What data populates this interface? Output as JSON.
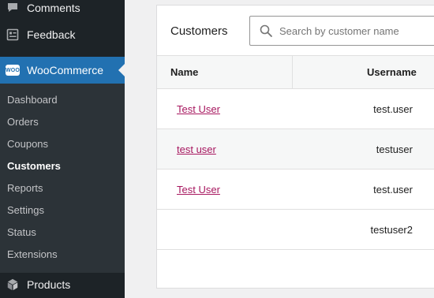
{
  "sidebar": {
    "top_items": [
      {
        "label": "Comments",
        "icon": "comment-icon"
      },
      {
        "label": "Feedback",
        "icon": "feedback-icon"
      }
    ],
    "woocommerce": {
      "label": "WooCommerce",
      "badge": "WOO",
      "icon": "woocommerce-icon"
    },
    "submenu": [
      "Dashboard",
      "Orders",
      "Coupons",
      "Customers",
      "Reports",
      "Settings",
      "Status",
      "Extensions"
    ],
    "current_submenu": "Customers",
    "products": {
      "label": "Products",
      "icon": "products-icon"
    }
  },
  "customers_card": {
    "title": "Customers",
    "search_placeholder": "Search by customer name"
  },
  "table": {
    "columns": [
      "Name",
      "Username"
    ],
    "rows": [
      {
        "name": "Test User",
        "username": "test.user"
      },
      {
        "name": "test user",
        "username": "testuser"
      },
      {
        "name": "Test User",
        "username": "test.user"
      },
      {
        "name": "",
        "username": "testuser2"
      }
    ]
  },
  "colors": {
    "sidebar_bg": "#1d2327",
    "submenu_bg": "#2c3338",
    "accent": "#2271b1",
    "link": "#a7175f"
  }
}
